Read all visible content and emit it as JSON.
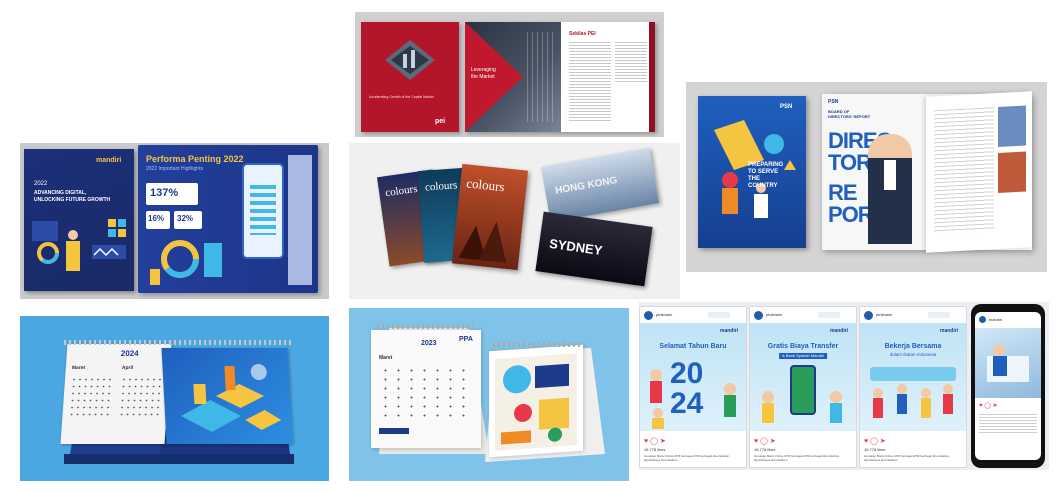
{
  "tiles": {
    "t1": {
      "cover_logo": "mandiri",
      "cover_year": "2022",
      "cover_title_1": "ADVANCING DIGITAL,",
      "cover_title_2": "UNLOCKING FUTURE GROWTH",
      "spread_title": "Performa Penting 2022",
      "spread_subtitle": "2022 Important Highlights",
      "stat_1": "137%",
      "stat_2": "16%",
      "stat_3": "32%"
    },
    "t2": {
      "cover_caption": "Accelerating Growth of the Capital Market",
      "cover_logo": "pei",
      "spread_text_1": "Leveraging",
      "spread_text_2": "the Market",
      "page_heading": "Sekilas PEI"
    },
    "t3": {
      "mag_title_1": "colours",
      "mag_title_2": "colours",
      "mag_title_3": "colours",
      "spread_word_1": "HONG KONG",
      "spread_word_2": "SYDNEY"
    },
    "t4": {
      "cover_logo": "PSN",
      "cover_text_1": "PREPARING",
      "cover_text_2": "TO SERVE",
      "cover_text_3": "THE",
      "cover_text_4": "COUNTRY",
      "spread_logo": "PSN",
      "spread_header_1": "BOARD OF",
      "spread_header_2": "DIRECTORS' REPORT",
      "big_word_1": "DIREC",
      "big_word_2": "TOR",
      "big_word_3": "RE",
      "big_word_4": "PORT"
    },
    "t5": {
      "year": "2024",
      "month_1": "Maret",
      "month_2": "April"
    },
    "t6": {
      "year": "2023",
      "logo": "PPA",
      "month": "Maret"
    },
    "t7": {
      "username": "ptnkbank",
      "follow": "Ikuti",
      "logo": "mandiri",
      "post_1_title_1": "Selamat Tahun Baru",
      "post_1_title_2": "20",
      "post_1_title_3": "24",
      "post_2_title_1": "Gratis Biaya Transfer",
      "post_2_title_2": "& Bank Syariah Mandiri",
      "post_3_title_1": "Bekerja Bersama",
      "post_3_title_2": "dalam Ikatan Indonesia",
      "likes": "16.778 likes",
      "caption": "Gunakan Bank Online ATM berbagai ATM berbagai #pernikahan #gratisbiaya #pernikahan",
      "phone_user": "mandiri"
    }
  },
  "colors": {
    "navy": "#1e3a8a",
    "red": "#b3162b",
    "blue_bg": "#4ba7e2",
    "light_blue_bg": "#7fc3e8"
  }
}
